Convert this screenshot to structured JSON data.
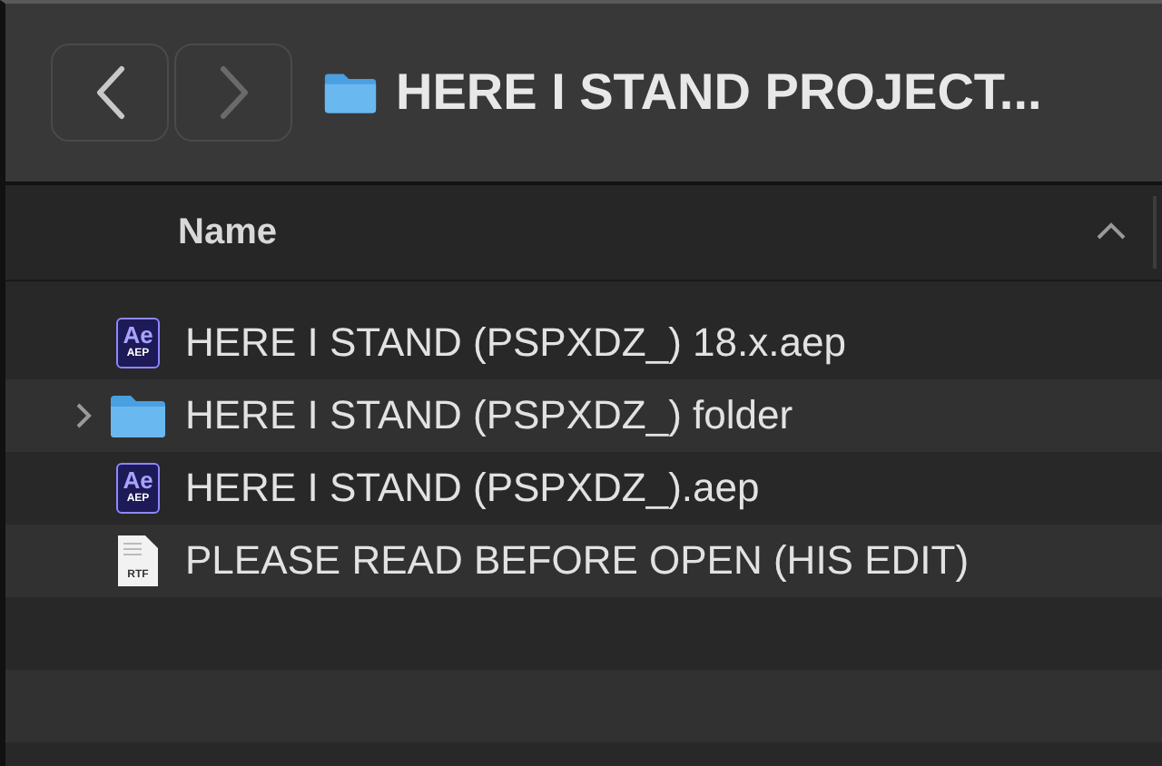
{
  "window": {
    "title": "HERE I STAND PROJECT..."
  },
  "column_header": {
    "label": "Name",
    "sort_ascending": true
  },
  "files": [
    {
      "kind": "aep",
      "name": "HERE I STAND (PSPXDZ_) 18.x.aep",
      "icon_text": "Ae",
      "icon_subtext": "AEP"
    },
    {
      "kind": "folder",
      "name": "HERE I STAND (PSPXDZ_) folder",
      "expanded": false
    },
    {
      "kind": "aep",
      "name": "HERE I STAND (PSPXDZ_).aep",
      "icon_text": "Ae",
      "icon_subtext": "AEP"
    },
    {
      "kind": "rtf",
      "name": "PLEASE READ BEFORE OPEN (HIS EDIT)",
      "icon_subtext": "RTF"
    }
  ]
}
